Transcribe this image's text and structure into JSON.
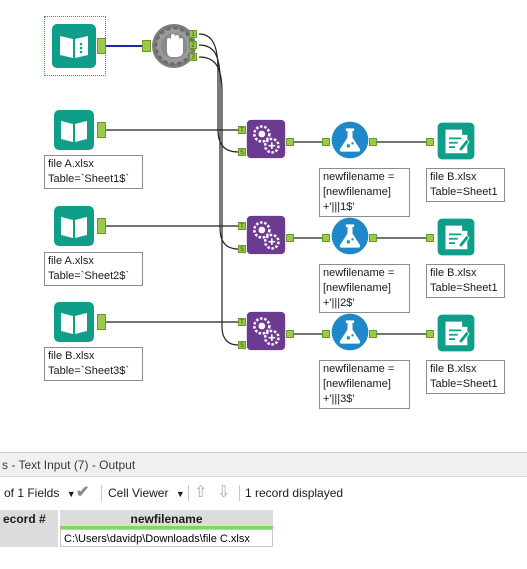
{
  "workflow": {
    "inputs": [
      {
        "file": "file A.xlsx",
        "table": "Table=`Sheet1$`"
      },
      {
        "file": "file A.xlsx",
        "table": "Table=`Sheet2$`"
      },
      {
        "file": "file B.xlsx",
        "table": "Table=`Sheet3$`"
      }
    ],
    "formulas": [
      {
        "line1": "newfilename =",
        "line2": "[newfilename]",
        "line3": "+'|||1$'"
      },
      {
        "line1": "newfilename =",
        "line2": "[newfilename]",
        "line3": "+'|||2$'"
      },
      {
        "line1": "newfilename =",
        "line2": "[newfilename]",
        "line3": "+'|||3$'"
      }
    ],
    "outputs": [
      {
        "file": "file B.xlsx",
        "table": "Table=Sheet1"
      },
      {
        "file": "file B.xlsx",
        "table": "Table=Sheet1"
      },
      {
        "file": "file B.xlsx",
        "table": "Table=Sheet1"
      }
    ],
    "test_anchors": [
      "1",
      "2",
      "3"
    ],
    "append_anchor_labels": {
      "target": "T",
      "source": "S"
    },
    "colors": {
      "input_tool": "#0f9e8a",
      "test_tool": "#8a8a8a",
      "append_tool": "#6b3b8f",
      "formula_tool": "#1f88c8",
      "output_tool": "#0f9e8a",
      "anchor": "#9bc94a",
      "wire_blue": "#2222aa",
      "wire": "#222222"
    }
  },
  "results": {
    "title": "s - Text Input (7) - Output",
    "fields_selector": "of 1 Fields",
    "viewer_selector": "Cell Viewer",
    "record_count": "1 record displayed",
    "columns": [
      "ecord #",
      "newfilename"
    ],
    "rows": [
      {
        "record": "",
        "newfilename": "C:\\Users\\davidp\\Downloads\\file C.xlsx"
      }
    ]
  }
}
